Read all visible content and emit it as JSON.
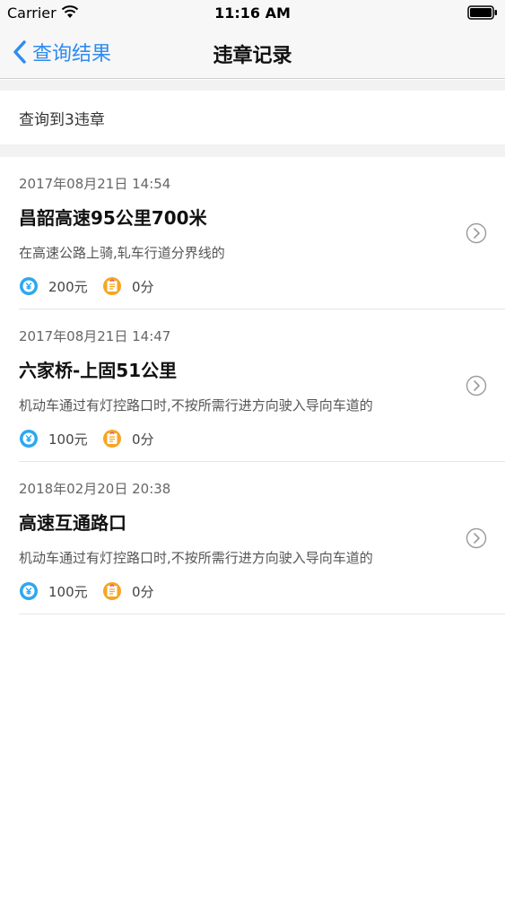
{
  "status_bar": {
    "carrier": "Carrier",
    "time": "11:16 AM"
  },
  "nav": {
    "back_label": "查询结果",
    "title": "违章记录"
  },
  "summary": {
    "text": "查询到3违章"
  },
  "records": [
    {
      "time": "2017年08月21日 14:54",
      "location": "昌韶高速95公里700米",
      "description": "在高速公路上骑,轧车行道分界线的",
      "fine": "200元",
      "points": "0分"
    },
    {
      "time": "2017年08月21日 14:47",
      "location": "六家桥-上固51公里",
      "description": "机动车通过有灯控路口时,不按所需行进方向驶入导向车道的",
      "fine": "100元",
      "points": "0分"
    },
    {
      "time": "2018年02月20日 20:38",
      "location": "高速互通路口",
      "description": "机动车通过有灯控路口时,不按所需行进方向驶入导向车道的",
      "fine": "100元",
      "points": "0分"
    }
  ],
  "icons": {
    "fine": "yuan-icon",
    "points": "points-icon",
    "arrow": "chevron-right-circle-icon"
  },
  "colors": {
    "accent": "#2f8cf0",
    "fine_icon": "#2ea7ee",
    "points_icon": "#f5a623"
  }
}
